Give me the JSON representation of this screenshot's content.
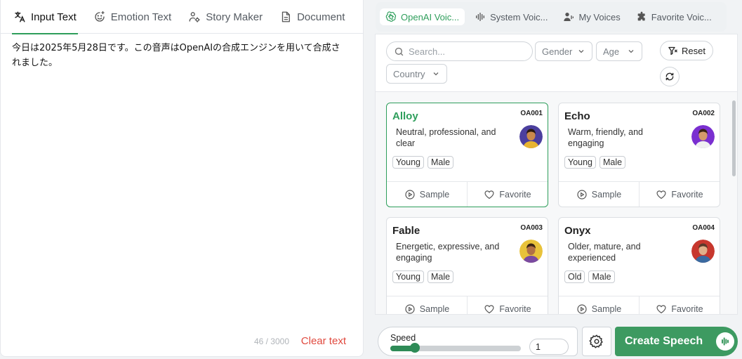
{
  "left_tabs": [
    {
      "label": "Input Text"
    },
    {
      "label": "Emotion Text"
    },
    {
      "label": "Story Maker"
    },
    {
      "label": "Document"
    }
  ],
  "editor": {
    "text": "今日は2025年5月28日です。この音声はOpenAIの合成エンジンを用いて合成されました。",
    "counter": "46 / 3000",
    "clear_label": "Clear text"
  },
  "voice_tabs": [
    {
      "label": "OpenAI Voic..."
    },
    {
      "label": "System Voic..."
    },
    {
      "label": "My Voices"
    },
    {
      "label": "Favorite Voic..."
    }
  ],
  "filters": {
    "search_placeholder": "Search...",
    "gender": "Gender",
    "age": "Age",
    "country": "Country",
    "reset_label": "Reset"
  },
  "voices": [
    {
      "name": "Alloy",
      "code": "OA001",
      "desc": "Neutral, professional, and clear",
      "tags": [
        "Young",
        "Male"
      ],
      "avatar_bg": "#4b3f9e",
      "skin": "#c98a4b",
      "hair": "#2a1a10",
      "shirt": "#e8b431"
    },
    {
      "name": "Echo",
      "code": "OA002",
      "desc": "Warm, friendly, and engaging",
      "tags": [
        "Young",
        "Male"
      ],
      "avatar_bg": "#7a2fd0",
      "skin": "#d49a6a",
      "hair": "#3a2414",
      "shirt": "#f0f0f0"
    },
    {
      "name": "Fable",
      "code": "OA003",
      "desc": "Energetic, expressive, and engaging",
      "tags": [
        "Young",
        "Male"
      ],
      "avatar_bg": "#e8c23a",
      "skin": "#b07045",
      "hair": "#3a2414",
      "shirt": "#7a4aa0"
    },
    {
      "name": "Onyx",
      "code": "OA004",
      "desc": "Older, mature, and experienced",
      "tags": [
        "Old",
        "Male"
      ],
      "avatar_bg": "#c7372d",
      "skin": "#e0b08a",
      "hair": "#5a3a2a",
      "shirt": "#3a6aa0"
    }
  ],
  "actions": {
    "sample": "Sample",
    "favorite": "Favorite"
  },
  "speed": {
    "label": "Speed",
    "value": "1",
    "level": 0.19
  },
  "create_label": "Create Speech",
  "colors": {
    "accent": "#2e9e5b",
    "danger": "#e04a3f"
  }
}
